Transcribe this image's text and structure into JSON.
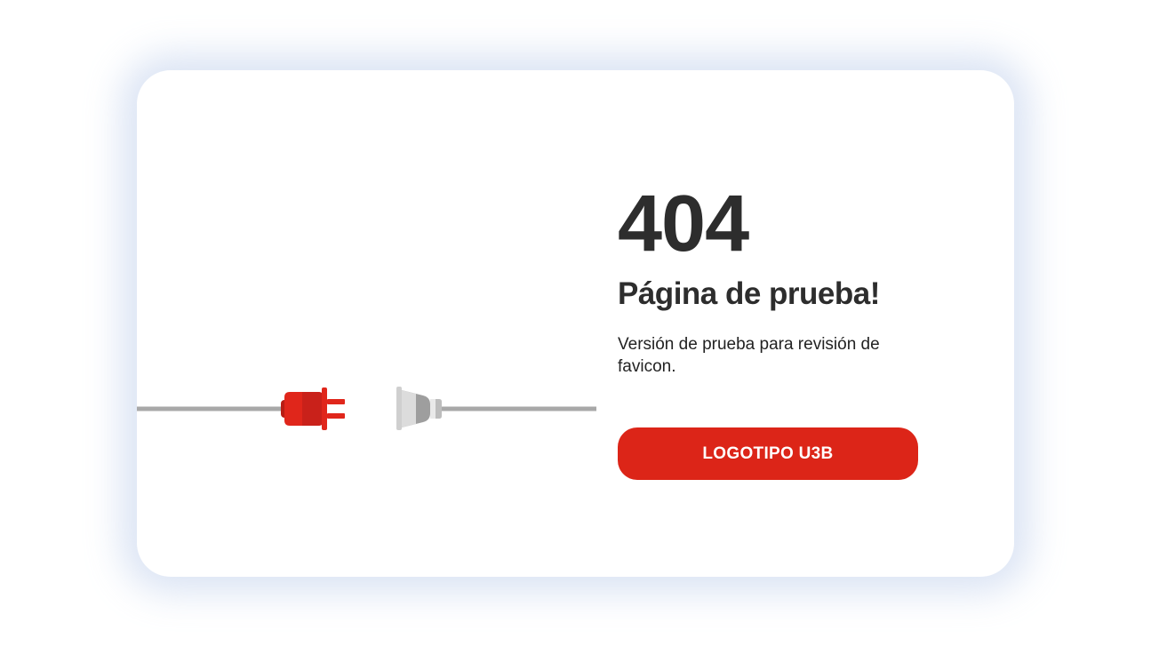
{
  "error": {
    "code": "404",
    "title": "Página de prueba!",
    "description": "Versión de prueba para revisión de favicon."
  },
  "cta": {
    "label": "LOGOTIPO U3B"
  },
  "illustration": {
    "icons": [
      "plug-icon",
      "socket-icon"
    ],
    "colors": {
      "cable": "#a8a8a8",
      "plug": "#e0261b",
      "plug_dark": "#b81d14",
      "socket": "#dcdcdc",
      "socket_dark": "#9e9e9e"
    }
  },
  "colors": {
    "accent": "#dc2518",
    "text": "#2d2d2d",
    "card_glow": "#b0c4e6"
  }
}
